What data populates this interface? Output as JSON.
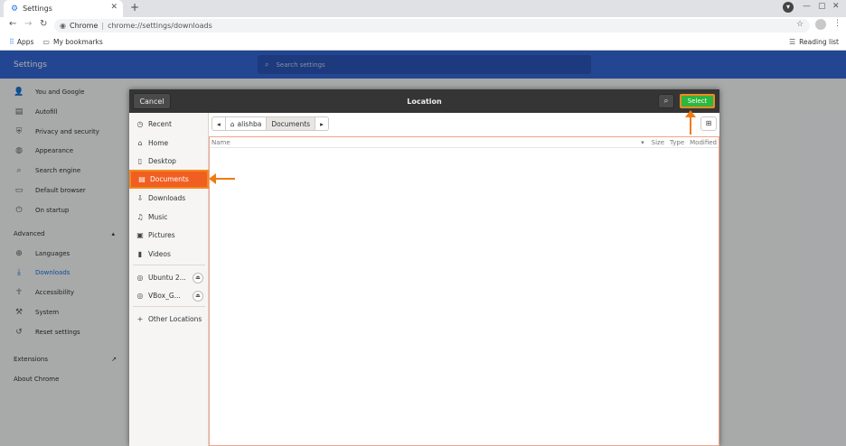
{
  "browser": {
    "tab_title": "Settings",
    "new_tab": "+",
    "address_site": "Chrome",
    "address_url": "chrome://settings/downloads",
    "bookmarks": {
      "apps": "Apps",
      "my_bookmarks": "My bookmarks",
      "reading_list": "Reading list"
    }
  },
  "settings": {
    "title": "Settings",
    "search_placeholder": "Search settings",
    "nav": {
      "you_and_google": "You and Google",
      "autofill": "Autofill",
      "privacy": "Privacy and security",
      "appearance": "Appearance",
      "search_engine": "Search engine",
      "default_browser": "Default browser",
      "on_startup": "On startup",
      "advanced": "Advanced",
      "languages": "Languages",
      "downloads": "Downloads",
      "accessibility": "Accessibility",
      "system": "System",
      "reset": "Reset settings",
      "extensions": "Extensions",
      "about": "About Chrome"
    }
  },
  "dialog": {
    "title": "Location",
    "cancel_label": "Cancel",
    "select_label": "Select",
    "places": {
      "recent": "Recent",
      "home": "Home",
      "desktop": "Desktop",
      "documents": "Documents",
      "downloads": "Downloads",
      "music": "Music",
      "pictures": "Pictures",
      "videos": "Videos",
      "ubuntu": "Ubuntu 2...",
      "vbox": "VBox_G...",
      "other": "Other Locations"
    },
    "path": {
      "home": "alishba",
      "current": "Documents"
    },
    "columns": {
      "name": "Name",
      "size": "Size",
      "type": "Type",
      "modified": "Modified"
    }
  },
  "colors": {
    "accent": "#3367d6",
    "select": "#2db640",
    "highlight": "#f15e22",
    "annotation": "#f08a1c"
  }
}
